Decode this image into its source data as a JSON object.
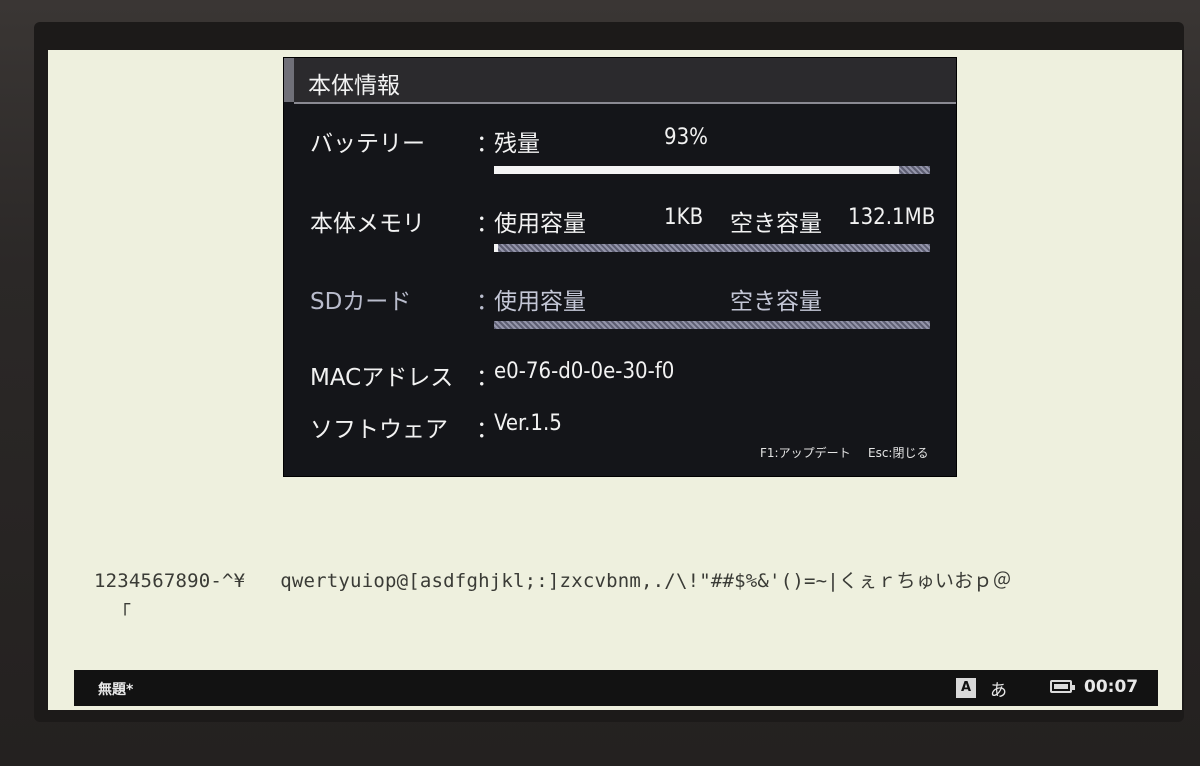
{
  "dialog": {
    "title": "本体情報",
    "battery": {
      "label": "バッテリー",
      "colon": "：",
      "sub": "残量",
      "value": "93%",
      "level_percent": 93
    },
    "memory": {
      "label": "本体メモリ",
      "colon": "：",
      "used_label": "使用容量",
      "used_value": "1KB",
      "free_label": "空き容量",
      "free_value": "132.1MB",
      "used_fraction": 0.01
    },
    "sd": {
      "label": "SDカード",
      "colon": "：",
      "used_label": "使用容量",
      "free_label": "空き容量",
      "used_fraction": 0
    },
    "mac": {
      "label": "MACアドレス",
      "colon": "：",
      "value": "e0-76-d0-0e-30-f0"
    },
    "software": {
      "label": "ソフトウェア",
      "colon": "：",
      "value": "Ver.1.5"
    },
    "hints": {
      "update": "F1:アップデート",
      "close": "Esc:閉じる"
    }
  },
  "editor": {
    "line1": "1234567890-^¥   qwertyuiop@[asdfghjkl;:]zxcvbnm,./\\!\"##$%&'()=~|くぇｒちゅいおｐ＠",
    "line2": "「"
  },
  "statusbar": {
    "document_title": "無題*",
    "ime_icon": "A",
    "ime_mode": "あ",
    "time": "00:07"
  }
}
